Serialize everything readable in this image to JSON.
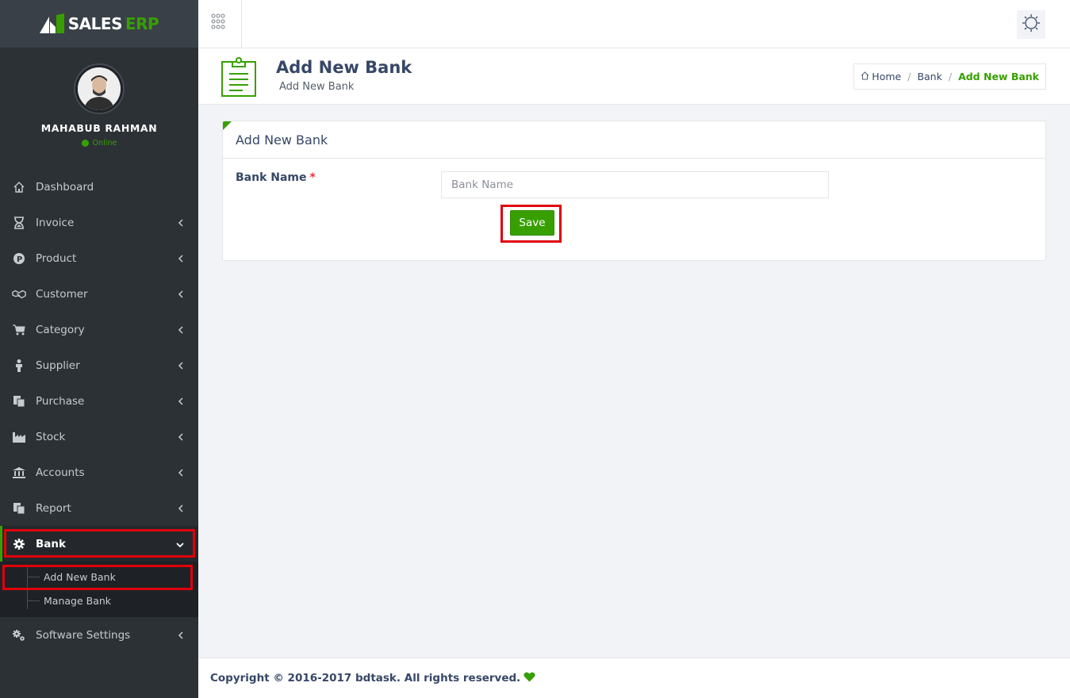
{
  "brand": {
    "name_part1": "SALES",
    "name_part2": "ERP",
    "accent": "#37a000"
  },
  "user": {
    "name": "MAHABUB RAHMAN",
    "status": "Online"
  },
  "sidebar": {
    "items": [
      {
        "label": "Dashboard",
        "icon": "home-icon"
      },
      {
        "label": "Invoice",
        "icon": "hourglass-icon"
      },
      {
        "label": "Product",
        "icon": "product-p-icon"
      },
      {
        "label": "Customer",
        "icon": "handshake-icon"
      },
      {
        "label": "Category",
        "icon": "cart-icon"
      },
      {
        "label": "Supplier",
        "icon": "person-icon"
      },
      {
        "label": "Purchase",
        "icon": "copy-icon"
      },
      {
        "label": "Stock",
        "icon": "factory-icon"
      },
      {
        "label": "Accounts",
        "icon": "bank-building-icon"
      },
      {
        "label": "Report",
        "icon": "copy-icon"
      },
      {
        "label": "Bank",
        "icon": "gear-icon"
      },
      {
        "label": "Software Settings",
        "icon": "gears-icon"
      }
    ],
    "bank_submenu": [
      "Add New Bank",
      "Manage Bank"
    ]
  },
  "header": {
    "title": "Add New Bank",
    "subtitle": "Add New Bank",
    "breadcrumb": [
      "Home",
      "Bank",
      "Add New Bank"
    ]
  },
  "form": {
    "panel_title": "Add New Bank",
    "bank_name_label": "Bank Name",
    "required_mark": "*",
    "bank_name_placeholder": "Bank Name",
    "bank_name_value": "",
    "save_label": "Save"
  },
  "footer": {
    "text": "Copyright © 2016-2017 bdtask. All rights reserved."
  }
}
